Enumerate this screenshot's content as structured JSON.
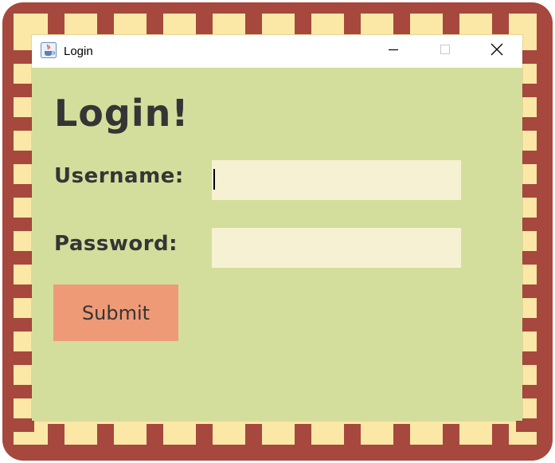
{
  "window": {
    "title": "Login",
    "icon": "java-cup-icon",
    "controls": [
      "minimize-icon",
      "maximize-icon",
      "close-icon"
    ]
  },
  "form": {
    "heading": "Login!",
    "username_label": "Username:",
    "username_value": "",
    "password_label": "Password:",
    "password_value": "",
    "submit_label": "Submit"
  },
  "colors": {
    "frame": "#A6483E",
    "stripe": "#FBE8A6",
    "panel": "#D4DE9C",
    "field": "#F6F1D2",
    "button": "#EF9A77",
    "text": "#353535"
  }
}
